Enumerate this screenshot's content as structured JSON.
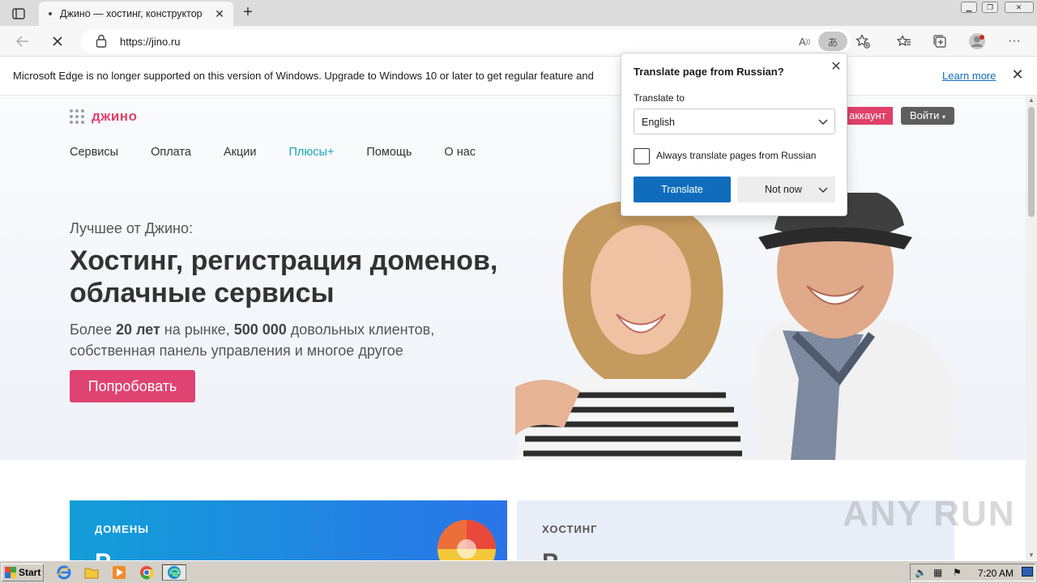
{
  "browser": {
    "tab_title": "Джино — хостинг, конструктор",
    "url": "https://jino.ru",
    "infobar_text": "Microsoft Edge is no longer supported on this version of Windows. Upgrade to Windows 10 or later to get regular feature and",
    "infobar_link": "Learn more"
  },
  "site": {
    "logo": "джино",
    "account_button": "аккаунт",
    "login_button": "Войти",
    "nav": [
      "Сервисы",
      "Оплата",
      "Акции",
      "Плюсы",
      "Помощь",
      "О нас"
    ],
    "nav_plus_suffix": "+",
    "subtitle": "Лучшее от Джино:",
    "headline": "Хостинг, регистрация доменов, облачные сервисы",
    "desc_1": "Более ",
    "desc_2": "20 лет",
    "desc_3": " на рынке, ",
    "desc_4": "500 000",
    "desc_5": " довольных клиентов,",
    "desc_line2": "собственная панель управления и многое другое",
    "try_button": "Попробовать",
    "card1_label": "ДОМЕНЫ",
    "card1_big": "Р",
    "card2_label": "ХОСТИНГ",
    "card2_big": "Р"
  },
  "translate_popup": {
    "title": "Translate page from Russian?",
    "label": "Translate to",
    "selected_language": "English",
    "always_label": "Always translate pages from Russian",
    "translate_button": "Translate",
    "not_now_button": "Not now"
  },
  "watermark": "ANY RUN",
  "taskbar": {
    "start_label": "Start",
    "clock": "7:20 AM"
  },
  "colors": {
    "brand_pink": "#df4372",
    "edge_blue": "#0f6cbd",
    "plus_teal": "#1aa7b8"
  }
}
